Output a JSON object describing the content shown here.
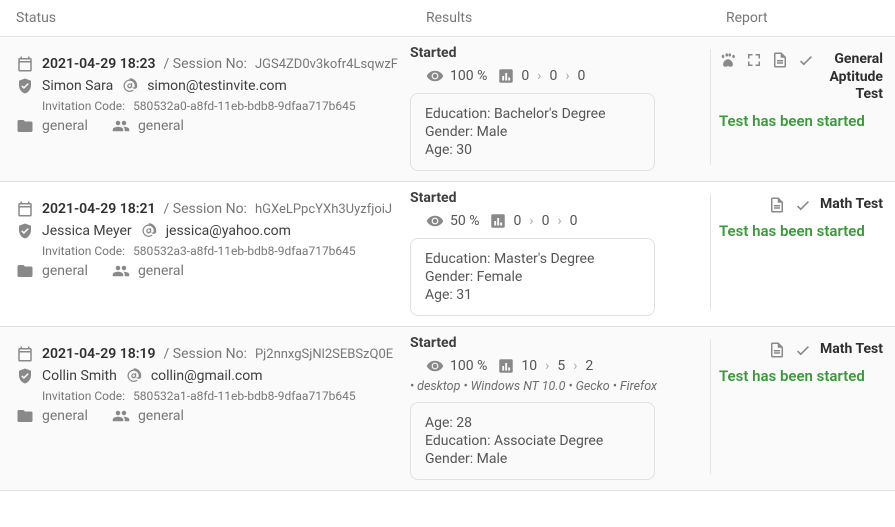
{
  "headers": {
    "status": "Status",
    "results": "Results",
    "report": "Report"
  },
  "labels": {
    "session_no": "Session No:",
    "invitation_code": "Invitation Code:",
    "education": "Education:",
    "gender": "Gender:",
    "age": "Age:"
  },
  "rows": [
    {
      "datetime": "2021-04-29 18:23",
      "session": "JGS4ZD0v3kofr4LsqwzF",
      "name": "Simon Sara",
      "email": "simon@testinvite.com",
      "code": "580532a0-a8fd-11eb-bdb8-9dfaa717b645",
      "folder": "general",
      "group": "general",
      "results": {
        "state": "Started",
        "progress": "100 %",
        "counts": [
          "0",
          "0",
          "0"
        ],
        "ua": "",
        "info": {
          "education": "Bachelor's Degree",
          "gender": "Male",
          "age": "30"
        }
      },
      "report": {
        "icons": [
          "paw",
          "expand",
          "doc",
          "check"
        ],
        "test": "General Aptitude Test",
        "status": "Test has been started"
      }
    },
    {
      "datetime": "2021-04-29 18:21",
      "session": "hGXeLPpcYXh3UyzfjoiJ",
      "name": "Jessica Meyer",
      "email": "jessica@yahoo.com",
      "code": "580532a3-a8fd-11eb-bdb8-9dfaa717b645",
      "folder": "general",
      "group": "general",
      "results": {
        "state": "Started",
        "progress": "50 %",
        "counts": [
          "0",
          "0",
          "0"
        ],
        "ua": "",
        "info": {
          "education": "Master's Degree",
          "gender": "Female",
          "age": "31"
        }
      },
      "report": {
        "icons": [
          "doc",
          "check"
        ],
        "test": "Math Test",
        "status": "Test has been started"
      }
    },
    {
      "datetime": "2021-04-29 18:19",
      "session": "Pj2nnxgSjNl2SEBSzQ0E",
      "name": "Collin Smith",
      "email": "collin@gmail.com",
      "code": "580532a1-a8fd-11eb-bdb8-9dfaa717b645",
      "folder": "general",
      "group": "general",
      "results": {
        "state": "Started",
        "progress": "100 %",
        "counts": [
          "10",
          "5",
          "2"
        ],
        "ua": "• desktop • Windows NT 10.0 • Gecko • Firefox",
        "info": {
          "age": "28",
          "education": "Associate Degree",
          "gender": "Male"
        }
      },
      "report": {
        "icons": [
          "doc",
          "check"
        ],
        "test": "Math Test",
        "status": "Test has been started"
      }
    }
  ]
}
